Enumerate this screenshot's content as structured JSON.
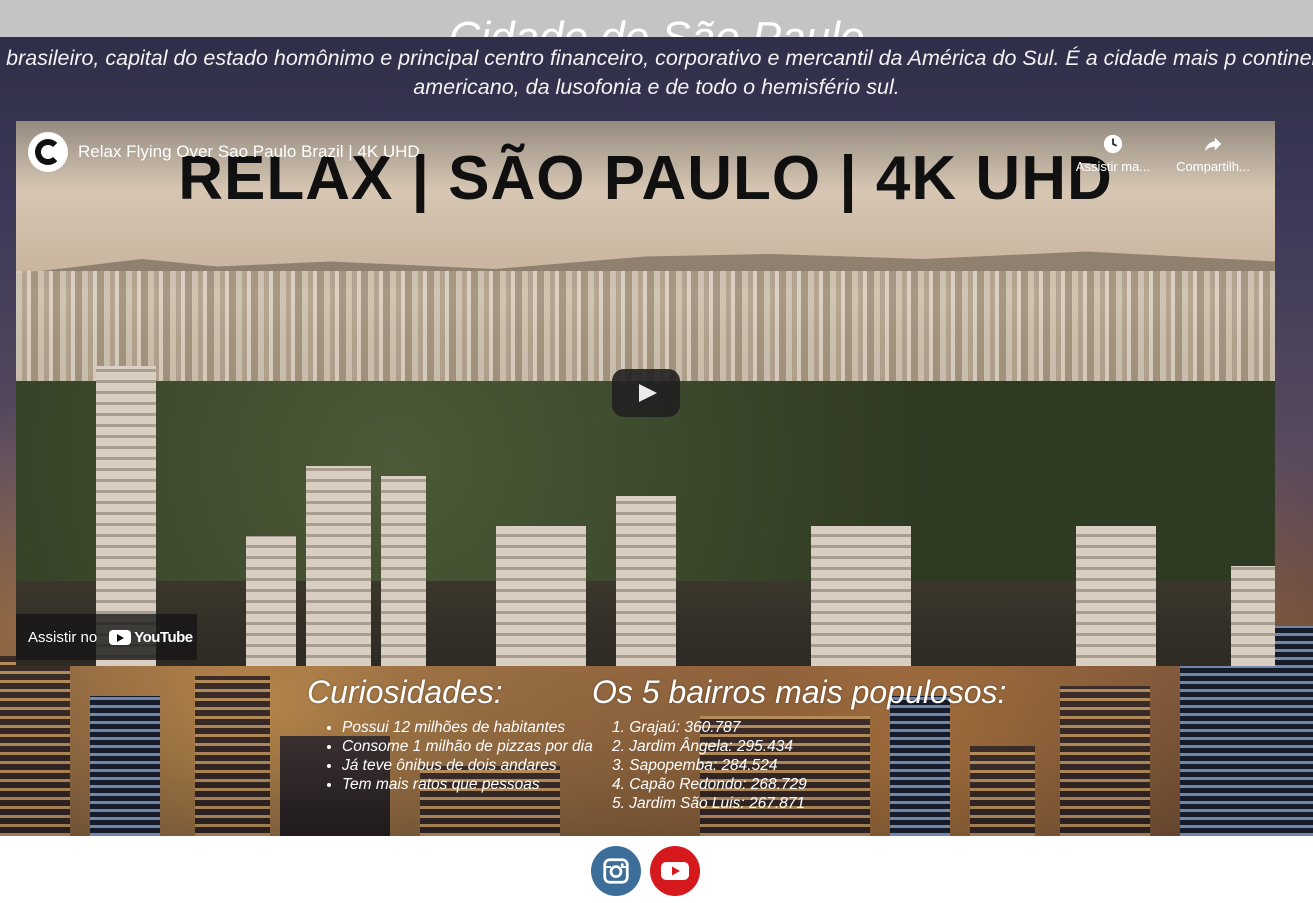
{
  "page": {
    "title": "Cidade de São Paulo",
    "intro": "pio brasileiro, capital do estado homônimo e principal centro financeiro, corporativo e mercantil da América do Sul. É a cidade mais p continente americano, da lusofonia e de todo o hemisfério sul."
  },
  "video": {
    "banner_text": "RELAX | SÃO PAULO | 4K UHD",
    "title": "Relax Flying Over Sao Paulo Brazil | 4K UHD",
    "watch_later_label": "Assistir ma...",
    "share_label": "Compartilh...",
    "watch_on_label": "Assistir no",
    "youtube_brand": "YouTube",
    "icons": [
      "channel-logo",
      "clock-icon",
      "share-icon",
      "play-icon",
      "youtube-icon"
    ]
  },
  "curiosities": {
    "heading": "Curiosidades:",
    "items": [
      "Possui 12 milhões de habitantes",
      "Consome 1 milhão de pizzas por dia",
      "Já teve ônibus de dois andares",
      "Tem mais ratos que pessoas"
    ]
  },
  "neighborhoods": {
    "heading": "Os 5 bairros mais populosos:",
    "items": [
      "Grajaú: 360.787",
      "Jardim Ângela: 295.434",
      "Sapopemba: 284.524",
      "Capão Redondo: 268.729",
      "Jardim São Luis: 267.871"
    ]
  },
  "footer": {
    "icons": [
      "instagram-icon",
      "youtube-icon"
    ],
    "colors": {
      "instagram": "#3d6d99",
      "youtube": "#d6191d"
    }
  }
}
